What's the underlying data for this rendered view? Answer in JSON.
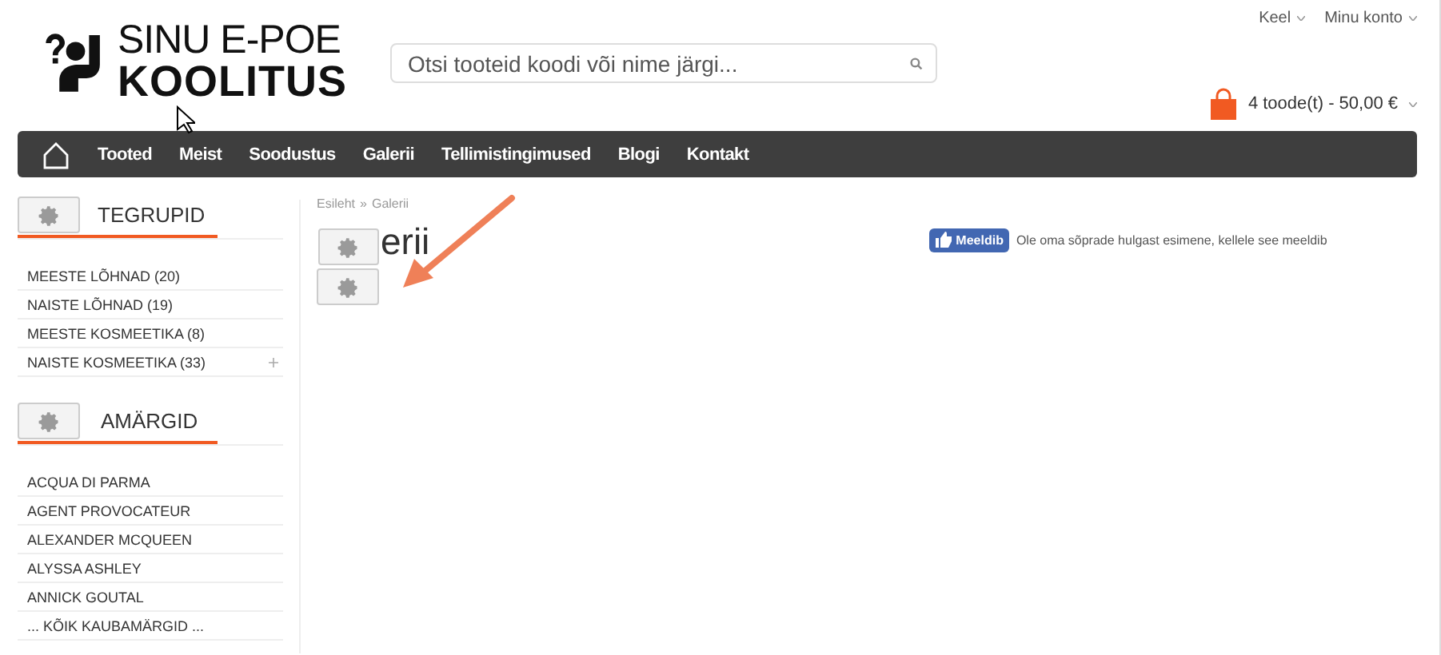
{
  "header": {
    "logo": {
      "line_1": "SINU E-POE",
      "line_2": "KOOLITUS"
    },
    "search": {
      "placeholder": "Otsi tooteid koodi või nime järgi..."
    },
    "top_links": [
      "Keel",
      "Minu konto"
    ],
    "cart": "4 toode(t) - 50,00 €"
  },
  "nav": {
    "items": [
      "Tooted",
      "Meist",
      "Soodustus",
      "Galerii",
      "Tellimistingimused",
      "Blogi",
      "Kontakt"
    ]
  },
  "sidebar": [
    {
      "title": "TEGRUPID",
      "items": [
        {
          "label": "MEESTE LÕHNAD (20)",
          "expandable": false
        },
        {
          "label": "NAISTE LÕHNAD (19)",
          "expandable": false
        },
        {
          "label": "MEESTE KOSMEETIKA (8)",
          "expandable": false
        },
        {
          "label": "NAISTE KOSMEETIKA (33)",
          "expandable": true
        }
      ]
    },
    {
      "title": "AMÄRGID",
      "items": [
        {
          "label": "ACQUA DI PARMA",
          "expandable": false
        },
        {
          "label": "AGENT PROVOCATEUR",
          "expandable": false
        },
        {
          "label": "ALEXANDER MCQUEEN",
          "expandable": false
        },
        {
          "label": "ALYSSA ASHLEY",
          "expandable": false
        },
        {
          "label": "ANNICK GOUTAL",
          "expandable": false
        },
        {
          "label": "... KÕIK KAUBAMÄRGID ...",
          "expandable": false
        }
      ]
    }
  ],
  "main": {
    "breadcrumb": [
      "Esileht",
      "Galerii"
    ],
    "breadcrumb_separator": "»",
    "title": "erii",
    "like": {
      "button": "Meeldib",
      "text": "Ole oma sõprade hulgast esimene, kellele see meeldib"
    }
  }
}
